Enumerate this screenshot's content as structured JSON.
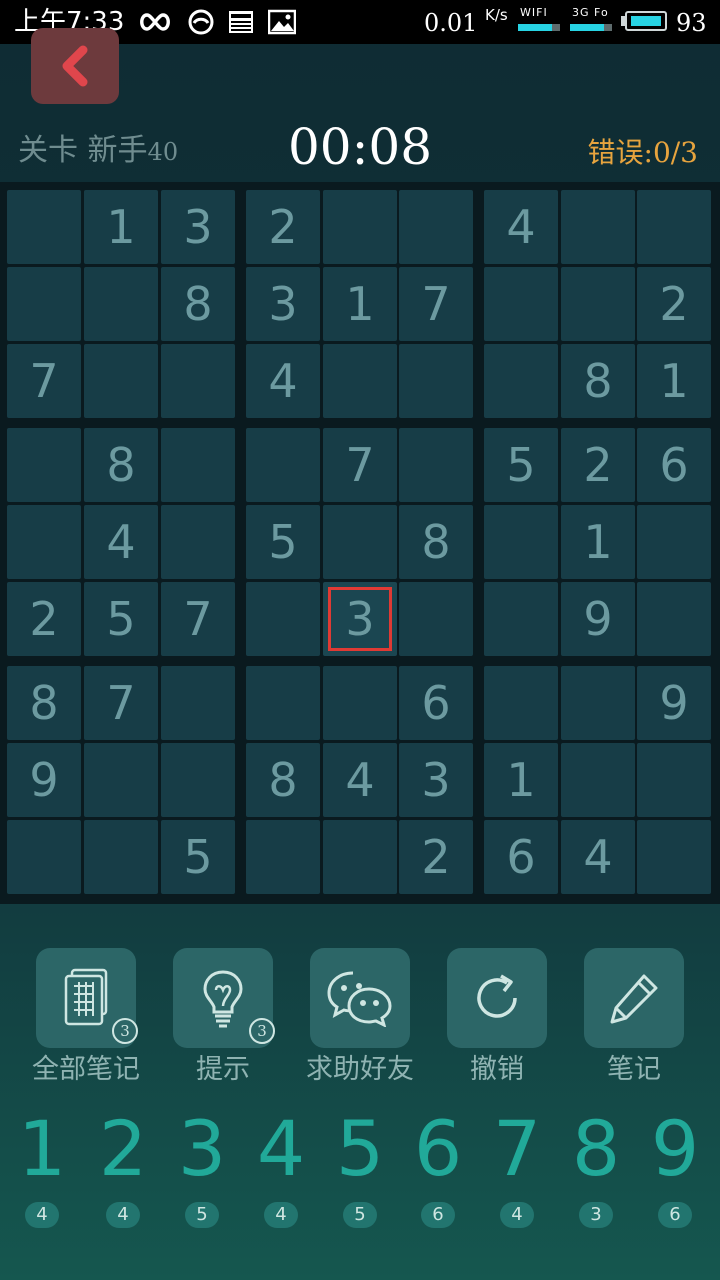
{
  "status_bar": {
    "time": "上午7:33",
    "speed": "0.01",
    "speed_unit": "K/s",
    "wifi_label": "WIFI",
    "network_label": "3G Fo",
    "battery": "93",
    "icons": [
      "infinity-icon",
      "app-circle-icon",
      "news-icon",
      "image-icon"
    ],
    "accent_color": "#27d3e3"
  },
  "header": {
    "level_label": "关卡 新手",
    "level_number": "40",
    "timer": "00:08",
    "mistakes_label": "错误:",
    "mistakes_value": "0/3"
  },
  "board": {
    "grid": [
      [
        "",
        "1",
        "3",
        "2",
        "",
        "",
        "4",
        "",
        ""
      ],
      [
        "",
        "",
        "8",
        "3",
        "1",
        "7",
        "",
        "",
        "2"
      ],
      [
        "7",
        "",
        "",
        "4",
        "",
        "",
        "",
        "8",
        "1"
      ],
      [
        "",
        "8",
        "",
        "",
        "7",
        "",
        "5",
        "2",
        "6"
      ],
      [
        "",
        "4",
        "",
        "5",
        "",
        "8",
        "",
        "1",
        ""
      ],
      [
        "2",
        "5",
        "7",
        "",
        "3",
        "",
        "",
        "9",
        ""
      ],
      [
        "8",
        "7",
        "",
        "",
        "",
        "6",
        "",
        "",
        "9"
      ],
      [
        "9",
        "",
        "",
        "8",
        "4",
        "3",
        "1",
        "",
        ""
      ],
      [
        "",
        "",
        "5",
        "",
        "",
        "2",
        "6",
        "4",
        ""
      ]
    ],
    "selected": {
      "row": 5,
      "col": 4
    },
    "selected_color": "#e03a34"
  },
  "tools": [
    {
      "label": "全部笔记",
      "icon": "all-notes-icon",
      "badge": "3"
    },
    {
      "label": "提示",
      "icon": "lightbulb-icon",
      "badge": "3"
    },
    {
      "label": "求助好友",
      "icon": "wechat-icon",
      "badge": ""
    },
    {
      "label": "撤销",
      "icon": "undo-icon",
      "badge": ""
    },
    {
      "label": "笔记",
      "icon": "pencil-icon",
      "badge": ""
    }
  ],
  "number_pad": [
    {
      "digit": "1",
      "count": "4"
    },
    {
      "digit": "2",
      "count": "4"
    },
    {
      "digit": "3",
      "count": "5"
    },
    {
      "digit": "4",
      "count": "4"
    },
    {
      "digit": "5",
      "count": "5"
    },
    {
      "digit": "6",
      "count": "6"
    },
    {
      "digit": "7",
      "count": "4"
    },
    {
      "digit": "8",
      "count": "3"
    },
    {
      "digit": "9",
      "count": "6"
    }
  ]
}
